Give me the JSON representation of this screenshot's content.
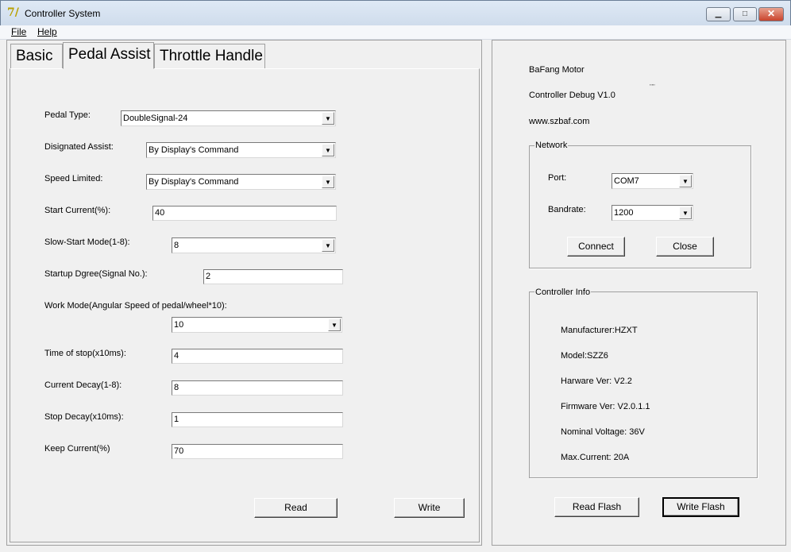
{
  "window": {
    "title": "Controller System",
    "min_icon": "minimize-icon",
    "max_icon": "maximize-icon",
    "close_icon": "close-icon",
    "min_glyph": "▁",
    "max_glyph": "□",
    "close_glyph": "✕"
  },
  "menu": {
    "file": "File",
    "help": "Help"
  },
  "tabs": [
    "Basic",
    "Pedal Assist",
    "Throttle Handle"
  ],
  "form": {
    "pedal_type": {
      "label": "Pedal Type:",
      "value": "DoubleSignal-24"
    },
    "designated_assist": {
      "label": "Disignated Assist:",
      "value": "By Display's Command"
    },
    "speed_limited": {
      "label": "Speed Limited:",
      "value": "By Display's Command"
    },
    "start_current": {
      "label": "Start Current(%):",
      "value": "40"
    },
    "slow_start": {
      "label": "Slow-Start Mode(1-8):",
      "value": "8"
    },
    "startup_degree": {
      "label": "Startup Dgree(Signal No.):",
      "value": "2"
    },
    "work_mode": {
      "label": "Work Mode(Angular Speed of pedal/wheel*10):",
      "value": "10"
    },
    "time_of_stop": {
      "label": "Time of stop(x10ms):",
      "value": "4"
    },
    "current_decay": {
      "label": "Current Decay(1-8):",
      "value": "8"
    },
    "stop_decay": {
      "label": "Stop Decay(x10ms):",
      "value": "1"
    },
    "keep_current": {
      "label": "Keep Current(%)",
      "value": "70"
    },
    "read": "Read",
    "write": "Write"
  },
  "info": {
    "line1": "BaFang Motor",
    "line2": "Controller Debug V1.0",
    "line3": "www.szbaf.com",
    "mark": "'''''"
  },
  "network": {
    "title": "Network",
    "port_label": "Port:",
    "port_value": "COM7",
    "baud_label": "Bandrate:",
    "baud_value": "1200",
    "connect": "Connect",
    "close": "Close"
  },
  "controller": {
    "title": "Controller Info",
    "manufacturer": "Manufacturer:HZXT",
    "model": "Model:SZZ6",
    "hw": "Harware Ver: V2.2",
    "fw": "Firmware Ver: V2.0.1.1",
    "voltage": "Nominal Voltage: 36V",
    "current": "Max.Current: 20A"
  },
  "flash": {
    "read": "Read Flash",
    "write": "Write Flash"
  },
  "dropdown_glyph": "▼"
}
